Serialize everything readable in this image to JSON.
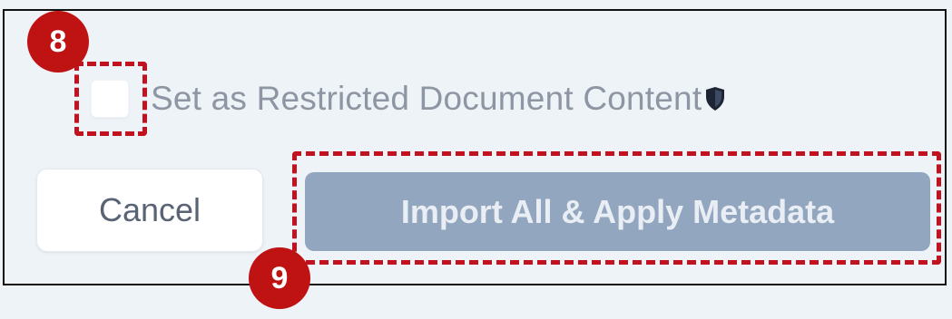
{
  "checkbox": {
    "label": "Set as Restricted Document Content",
    "checked": false,
    "icon": "shield-icon"
  },
  "buttons": {
    "cancel_label": "Cancel",
    "import_label": "Import All & Apply Metadata"
  },
  "annotations": {
    "step_8": "8",
    "step_9": "9",
    "highlight_color": "#c1121f"
  },
  "colors": {
    "import_button_bg": "#92a6bf",
    "badge_bg": "#bf1212"
  }
}
